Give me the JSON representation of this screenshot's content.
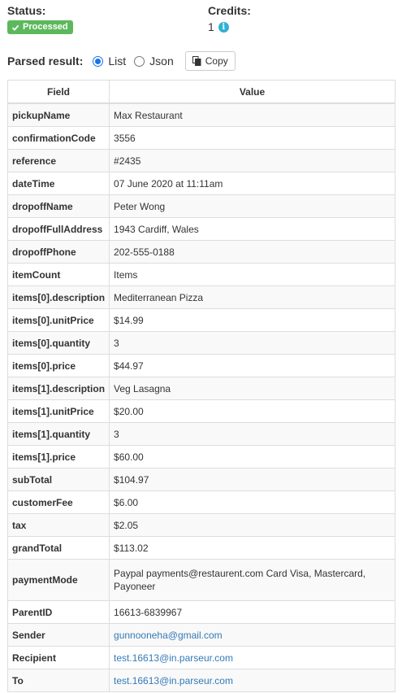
{
  "status": {
    "label": "Status:",
    "badge": "Processed"
  },
  "credits": {
    "label": "Credits:",
    "value": "1"
  },
  "parsed": {
    "label": "Parsed result:",
    "options": [
      "List",
      "Json"
    ],
    "selected": "List",
    "copy_label": "Copy"
  },
  "table": {
    "headers": [
      "Field",
      "Value"
    ],
    "rows": [
      {
        "field": "pickupName",
        "value": "Max Restaurant"
      },
      {
        "field": "confirmationCode",
        "value": "3556"
      },
      {
        "field": "reference",
        "value": "#2435"
      },
      {
        "field": "dateTime",
        "value": "07 June 2020 at 11:11am"
      },
      {
        "field": "dropoffName",
        "value": "Peter Wong"
      },
      {
        "field": "dropoffFullAddress",
        "value": "1943 Cardiff, Wales"
      },
      {
        "field": "dropoffPhone",
        "value": "202-555-0188"
      },
      {
        "field": "itemCount",
        "value": "Items"
      },
      {
        "field": "items[0].description",
        "value": "Mediterranean Pizza"
      },
      {
        "field": "items[0].unitPrice",
        "value": "$14.99"
      },
      {
        "field": "items[0].quantity",
        "value": "3"
      },
      {
        "field": "items[0].price",
        "value": "$44.97"
      },
      {
        "field": "items[1].description",
        "value": "Veg Lasagna"
      },
      {
        "field": "items[1].unitPrice",
        "value": "$20.00"
      },
      {
        "field": "items[1].quantity",
        "value": "3"
      },
      {
        "field": "items[1].price",
        "value": "$60.00"
      },
      {
        "field": "subTotal",
        "value": "$104.97"
      },
      {
        "field": "customerFee",
        "value": "$6.00"
      },
      {
        "field": "tax",
        "value": "$2.05"
      },
      {
        "field": "grandTotal",
        "value": "$113.02"
      },
      {
        "field": "paymentMode",
        "value": "Paypal payments@restaurent.com Card Visa, Mastercard, Payoneer"
      },
      {
        "field": "ParentID",
        "value": "16613-6839967"
      },
      {
        "field": "Sender",
        "value": "gunnooneha@gmail.com",
        "link": true
      },
      {
        "field": "Recipient",
        "value": "test.16613@in.parseur.com",
        "link": true
      },
      {
        "field": "To",
        "value": "test.16613@in.parseur.com",
        "link": true
      }
    ]
  },
  "colors": {
    "badge": "#5cb85c",
    "info": "#31b0d5",
    "link": "#337ab7",
    "radio": "#1a73e8"
  },
  "icons": [
    "check-icon",
    "info-icon",
    "copy-icon"
  ]
}
